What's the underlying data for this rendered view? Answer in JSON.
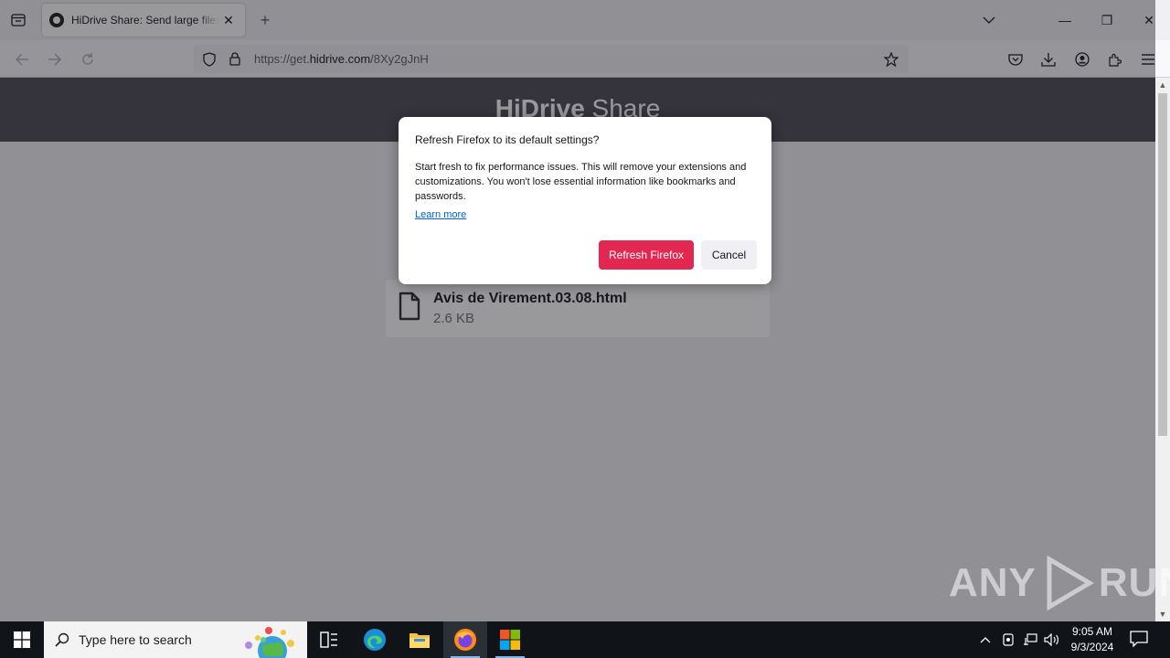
{
  "browser": {
    "tab": {
      "title": "HiDrive Share: Send large files f",
      "close_glyph": "✕"
    },
    "new_tab_glyph": "+",
    "url": {
      "prefix": "https://get.",
      "domain": "hidrive.com",
      "path": "/8Xy2gJnH"
    },
    "window_controls": {
      "minimize": "—",
      "restore": "❐",
      "close": "✕"
    }
  },
  "page": {
    "header": {
      "brand_bold": "HiDrive",
      "brand_light": " Share"
    },
    "file": {
      "name": "Avis de Virement.03.08.html",
      "size": "2.6 KB"
    }
  },
  "dialog": {
    "title": "Refresh Firefox to its default settings?",
    "body": "Start fresh to fix performance issues. This will remove your extensions and customizations. You won't lose essential information like bookmarks and passwords.",
    "link": "Learn more",
    "primary_button": "Refresh Firefox",
    "secondary_button": "Cancel"
  },
  "taskbar": {
    "search_placeholder": "Type here to search",
    "time": "9:05 AM",
    "date": "9/3/2024"
  },
  "watermark": {
    "left": "ANY",
    "right": "RUN"
  },
  "colors": {
    "accent": "#e22850",
    "link": "#0061e0",
    "taskbar": "#101418",
    "header": "#4a4a53"
  }
}
